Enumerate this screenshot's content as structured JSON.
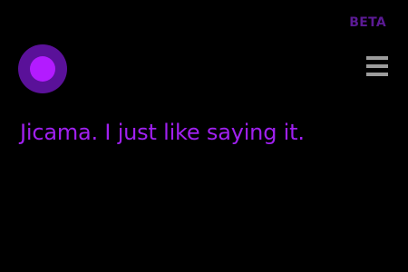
{
  "header": {
    "badge": "BETA",
    "menu_icon": "hamburger-menu-icon"
  },
  "assistant": {
    "orb_icon": "assistant-orb-icon"
  },
  "response": {
    "text": "Jicama. I just like saying it."
  },
  "colors": {
    "background": "#000000",
    "badge": "#5B1A94",
    "orb_outer": "#5A1199",
    "orb_inner": "#B31BFF",
    "response_text": "#A020F0",
    "menu_icon": "#9C9C9C"
  }
}
